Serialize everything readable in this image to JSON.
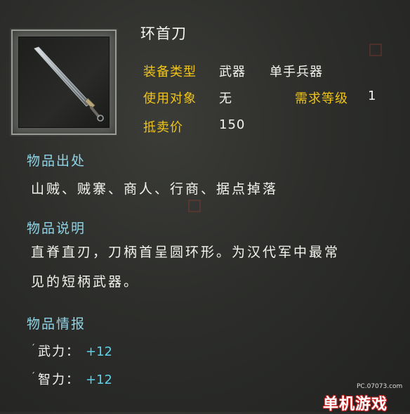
{
  "item": {
    "name": "环首刀",
    "icon": "sword-icon"
  },
  "attributes": {
    "equip_type_label": "装备类型",
    "equip_type_value": "武器",
    "equip_subtype_value": "单手兵器",
    "user_label": "使用对象",
    "user_value": "无",
    "level_label": "需求等级",
    "level_value": "1",
    "price_label": "抵卖价",
    "price_value": "150"
  },
  "source": {
    "heading": "物品出处",
    "text": "山贼、贼寨、商人、行商、据点掉落"
  },
  "description": {
    "heading": "物品说明",
    "line1": "直脊直刃，刀柄首呈圆环形。为汉代军中最常",
    "line2": "见的短柄武器。"
  },
  "info": {
    "heading": "物品情报",
    "stats": [
      {
        "label": "武力：",
        "value": "+12"
      },
      {
        "label": "智力：",
        "value": "+12"
      }
    ]
  },
  "watermark": {
    "site": "PC.07073.com",
    "logo": "单机游戏"
  },
  "colors": {
    "label_gold": "#f0c419",
    "heading_cyan": "#8fd4e6",
    "bonus_cyan": "#5fd0e8"
  }
}
